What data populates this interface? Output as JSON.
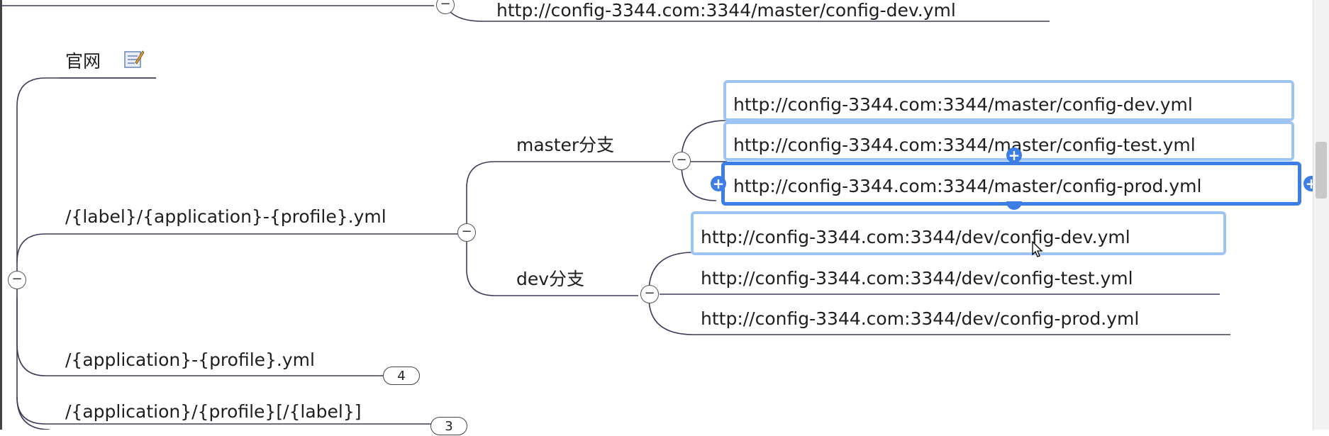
{
  "top_node": {
    "text": "http://config-3344.com:3344/master/config-dev.yml"
  },
  "branch_official": {
    "label": "官网"
  },
  "branch_label_app_profile": {
    "label": "/{label}/{application}-{profile}.yml"
  },
  "branch_app_profile": {
    "label": "/{application}-{profile}.yml",
    "badge": "4"
  },
  "branch_app_profile_label": {
    "label": "/{application}/{profile}[/{label}]",
    "badge": "3"
  },
  "master_branch": {
    "label": "master分支",
    "items": [
      "http://config-3344.com:3344/master/config-dev.yml",
      "http://config-3344.com:3344/master/config-test.yml",
      "http://config-3344.com:3344/master/config-prod.yml"
    ]
  },
  "dev_branch": {
    "label": "dev分支",
    "items": [
      "http://config-3344.com:3344/dev/config-dev.yml",
      "http://config-3344.com:3344/dev/config-test.yml",
      "http://config-3344.com:3344/dev/config-prod.yml"
    ]
  },
  "icons": {
    "collapse": "collapse-icon",
    "note": "note-icon",
    "add": "add-icon",
    "cursor": "mouse-cursor-icon"
  },
  "colors": {
    "selection_light": "#9ec3f5",
    "selection_active": "#3d7de6",
    "line": "#3c3c5a"
  },
  "toggle_symbol": "−",
  "plus_symbol": "+"
}
